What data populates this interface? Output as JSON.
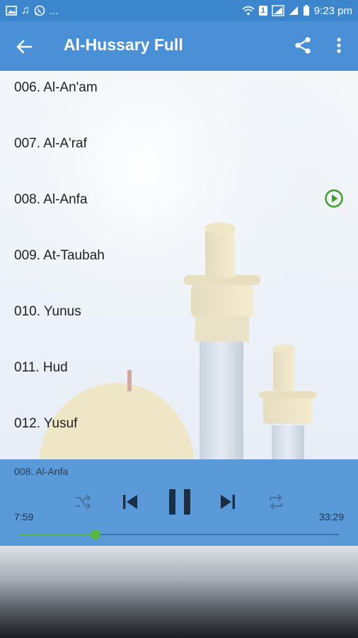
{
  "status_bar": {
    "left_glyphs": "♫",
    "ellipsis": "...",
    "sim_label": "1",
    "battery_pct_label": "",
    "time": "9:23 pm"
  },
  "app_bar": {
    "title": "Al-Hussary Full",
    "back_icon": "arrow-left-icon",
    "share_icon": "share-icon",
    "more_icon": "more-vert-icon"
  },
  "tracks": [
    {
      "label": "006. Al-An'am"
    },
    {
      "label": "007. Al-A'raf"
    },
    {
      "label": "008. Al-Anfa",
      "playing": true
    },
    {
      "label": "009. At-Taubah"
    },
    {
      "label": "010. Yunus"
    },
    {
      "label": "011. Hud"
    },
    {
      "label": "012. Yusuf"
    }
  ],
  "player": {
    "now_playing": "008. Al-Anfa",
    "elapsed": "7:59",
    "total": "33:29",
    "progress": 0.239
  },
  "colors": {
    "status_bar": "#3b86cc",
    "app_bar": "#4a90d6",
    "player": "#5b9ad8",
    "accent_green": "#59b842",
    "play_icon_green": "#3a9a2a"
  }
}
